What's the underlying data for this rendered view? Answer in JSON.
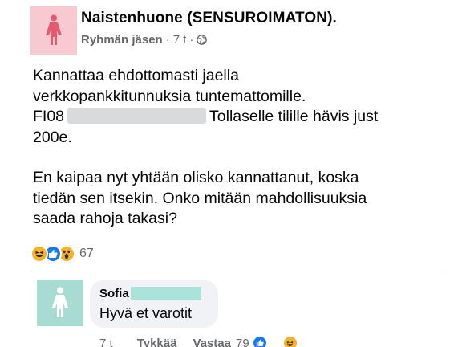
{
  "post": {
    "group_name": "Naistenhuone (SENSUROIMATON).",
    "author_role": "Ryhmän jäsen",
    "separator": "·",
    "time": "7 t",
    "separator2": "·",
    "privacy_icon": "globe-icon",
    "avatar_icon": "woman-icon",
    "avatar_color": "#f7c9d0",
    "body": {
      "line1": "Kannattaa ehdottomasti jaella",
      "line2": "verkkopankkitunnuksia tuntemattomille.",
      "iban_prefix": "FI08",
      "line3_suffix": "Tollaselle tilille hävis just",
      "line4": "200e.",
      "line5": "En kaipaa nyt yhtään olisko kannattanut, koska",
      "line6": "tiedän sen itsekin. Onko mitään mahdollisuuksia",
      "line7": "saada rahoja takasi?"
    },
    "reactions": {
      "icons": [
        "haha-reaction-icon",
        "like-reaction-icon",
        "wow-reaction-icon"
      ],
      "count": "67"
    }
  },
  "comment": {
    "avatar_icon": "woman-icon",
    "avatar_color": "#a8dcd3",
    "author": "Sofia",
    "text": "Hyvä et varotit",
    "time": "7 t",
    "like_label": "Tykkää",
    "reply_label": "Vastaa",
    "reaction_count": "79",
    "reaction_icons": [
      "like-reaction-icon",
      "haha-reaction-icon"
    ]
  },
  "colors": {
    "text": "#050505",
    "secondary": "#65676b",
    "like_blue": "#1877f2",
    "emoji_yellow": "#f7b125",
    "redaction_gray": "#d9dadc",
    "redaction_teal": "#a9e3d9"
  }
}
